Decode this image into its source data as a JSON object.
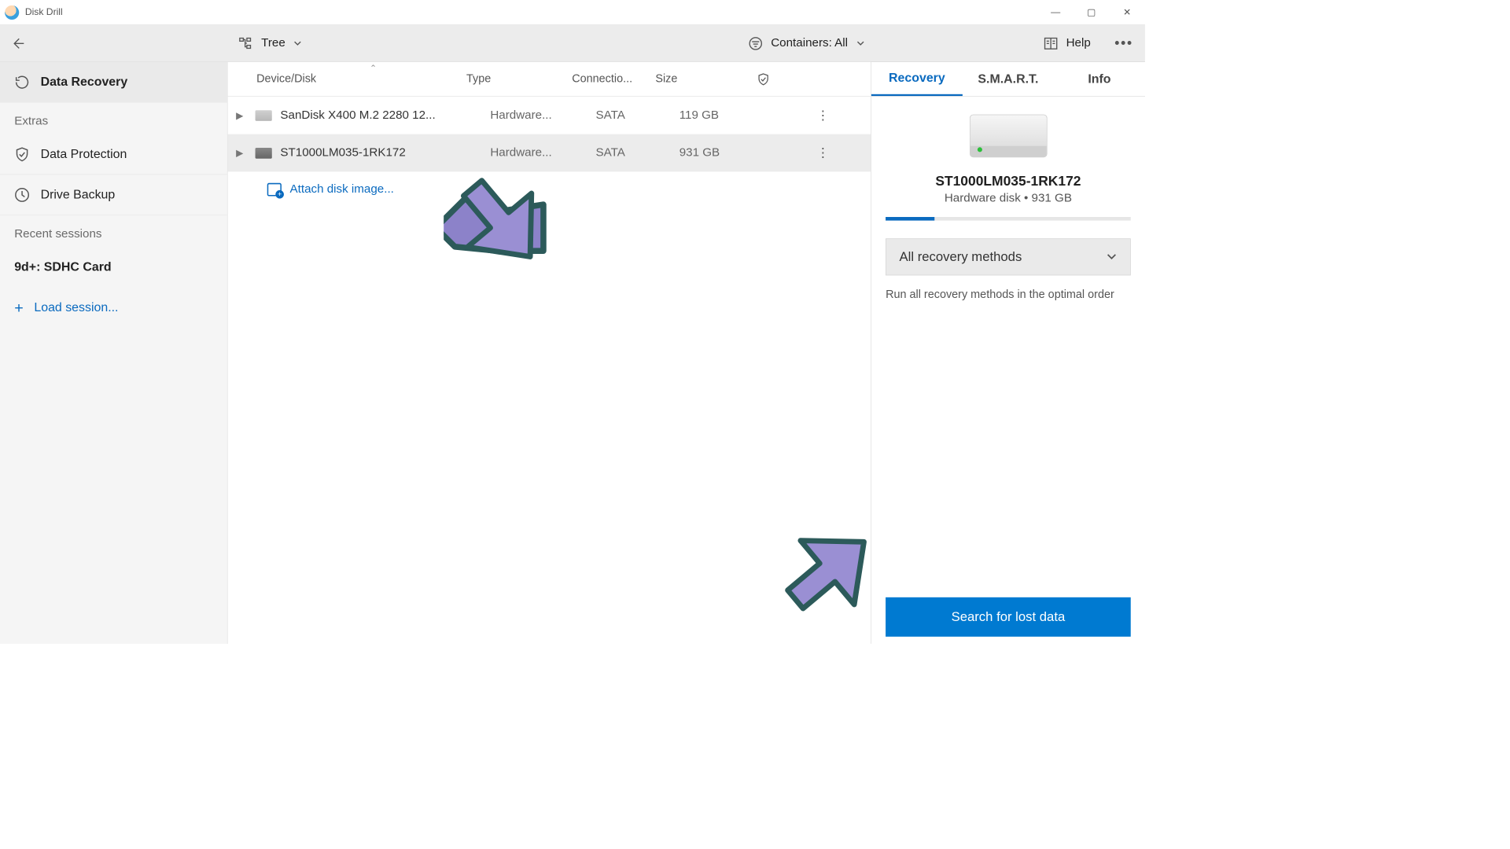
{
  "titlebar": {
    "app_name": "Disk Drill"
  },
  "toolbar": {
    "view_label": "Tree",
    "containers_label": "Containers: All",
    "help_label": "Help"
  },
  "sidebar": {
    "data_recovery": "Data Recovery",
    "extras_header": "Extras",
    "data_protection": "Data Protection",
    "drive_backup": "Drive Backup",
    "recent_header": "Recent sessions",
    "recent_item": "9d+: SDHC Card",
    "load_session": "Load session..."
  },
  "table": {
    "headers": {
      "device": "Device/Disk",
      "type": "Type",
      "connection": "Connectio...",
      "size": "Size"
    },
    "rows": [
      {
        "name": "SanDisk X400 M.2 2280 12...",
        "type": "Hardware...",
        "connection": "SATA",
        "size": "119 GB"
      },
      {
        "name": "ST1000LM035-1RK172",
        "type": "Hardware...",
        "connection": "SATA",
        "size": "931 GB"
      }
    ],
    "attach_label": "Attach disk image..."
  },
  "rpanel": {
    "tabs": {
      "recovery": "Recovery",
      "smart": "S.M.A.R.T.",
      "info": "Info"
    },
    "drive_name": "ST1000LM035-1RK172",
    "drive_subtitle": "Hardware disk • 931 GB",
    "methods_label": "All recovery methods",
    "methods_desc": "Run all recovery methods in the optimal order",
    "search_button": "Search for lost data"
  }
}
